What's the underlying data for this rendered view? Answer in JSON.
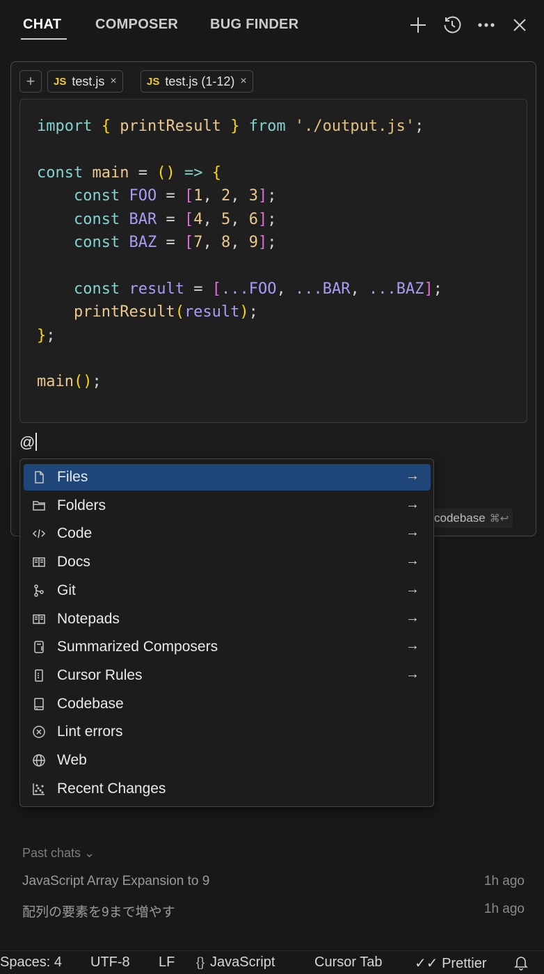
{
  "header": {
    "tabs": [
      {
        "label": "CHAT",
        "active": true
      },
      {
        "label": "COMPOSER",
        "active": false
      },
      {
        "label": "BUG FINDER",
        "active": false
      }
    ],
    "icons": [
      "plus-icon",
      "history-icon",
      "more-icon",
      "close-icon"
    ]
  },
  "context": {
    "chips": [
      {
        "badge": "JS",
        "label": "test.js",
        "close": "×"
      },
      {
        "badge": "JS",
        "label": "test.js (1-12)",
        "close": "×"
      }
    ]
  },
  "code": {
    "lines": [
      "import { printResult } from './output.js';",
      "",
      "const main = () => {",
      "    const FOO = [1, 2, 3];",
      "    const BAR = [4, 5, 6];",
      "    const BAZ = [7, 8, 9];",
      "",
      "    const result = [...FOO, ...BAR, ...BAZ];",
      "    printResult(result);",
      "};",
      "",
      "main();"
    ]
  },
  "input": {
    "value": "@"
  },
  "hint": {
    "label": "codebase",
    "shortcut": "⌘↩"
  },
  "mention_menu": {
    "items": [
      {
        "label": "Files",
        "icon": "file-icon",
        "arrow": "→",
        "selected": true
      },
      {
        "label": "Folders",
        "icon": "folder-icon",
        "arrow": "→"
      },
      {
        "label": "Code",
        "icon": "code-icon",
        "arrow": "→"
      },
      {
        "label": "Docs",
        "icon": "book-icon",
        "arrow": "→"
      },
      {
        "label": "Git",
        "icon": "git-icon",
        "arrow": "→"
      },
      {
        "label": "Notepads",
        "icon": "notepad-icon",
        "arrow": "→"
      },
      {
        "label": "Summarized Composers",
        "icon": "composer-icon",
        "arrow": "→"
      },
      {
        "label": "Cursor Rules",
        "icon": "rules-icon",
        "arrow": "→"
      },
      {
        "label": "Codebase",
        "icon": "codebase-icon",
        "arrow": ""
      },
      {
        "label": "Lint errors",
        "icon": "lint-error-icon",
        "arrow": ""
      },
      {
        "label": "Web",
        "icon": "globe-icon",
        "arrow": ""
      },
      {
        "label": "Recent Changes",
        "icon": "recent-changes-icon",
        "arrow": ""
      }
    ]
  },
  "past_chats": {
    "header": "Past chats ⌄",
    "items": [
      {
        "title": "JavaScript Array Expansion to 9",
        "time": "1h ago"
      },
      {
        "title": "配列の要素を9まで増やす",
        "time": "1h ago"
      }
    ]
  },
  "status_bar": {
    "spaces": "Spaces: 4",
    "encoding": "UTF-8",
    "eol": "LF",
    "language_icon": "{}",
    "language": "JavaScript",
    "cursor_tab": "Cursor Tab",
    "prettier": "✓✓ Prettier",
    "bell": "bell-icon"
  },
  "colors": {
    "background": "#181818",
    "selected": "#1f4678",
    "js_badge": "#f0c93b"
  }
}
